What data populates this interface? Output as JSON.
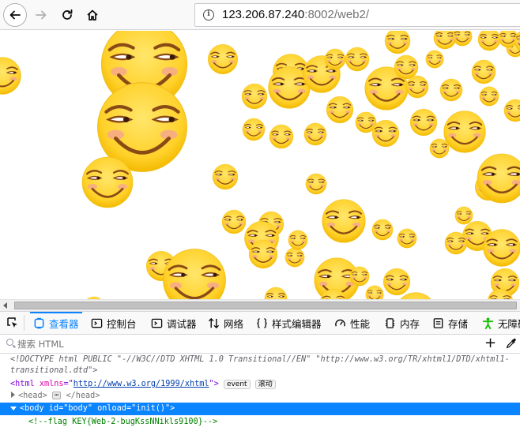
{
  "browser": {
    "url_host": "123.206.87.240",
    "url_rest": ":8002/web2/"
  },
  "devtools": {
    "tabs": [
      {
        "label": "查看器",
        "icon": "inspector-icon",
        "selected": true
      },
      {
        "label": "控制台",
        "icon": "console-icon"
      },
      {
        "label": "调试器",
        "icon": "debugger-icon"
      },
      {
        "label": "网络",
        "icon": "network-icon"
      },
      {
        "label": "样式编辑器",
        "icon": "style-editor-icon"
      },
      {
        "label": "性能",
        "icon": "performance-icon"
      },
      {
        "label": "内存",
        "icon": "memory-icon"
      },
      {
        "label": "存储",
        "icon": "storage-icon"
      },
      {
        "label": "无障碍",
        "icon": "accessibility-icon"
      }
    ],
    "search_placeholder": "搜索 HTML",
    "markup": {
      "doctype_line1": "<!DOCTYPE html PUBLIC \"-//W3C//DTD XHTML 1.0 Transitional//EN\" \"http://www.w3.org/TR/xhtml1/DTD/xhtml1-",
      "doctype_line2": "transitional.dtd\">",
      "html_open": "<html",
      "html_attr": "xmlns",
      "html_eq": "=\"",
      "html_val": "http://www.w3.org/1999/xhtml",
      "html_close": "\">",
      "badge_event": "event",
      "badge_scroll": "滚动",
      "head_open": "<head>",
      "head_dots": "⋯",
      "head_close": "</head>",
      "body_line": "<body id=\"body\" onload=\"init()\">",
      "comment_line": "<!--flag KEY{Web-2-bugKssNNikls9100}-->"
    }
  },
  "colors": {
    "accent": "#0a84ff",
    "smiley": "#ffd23f"
  }
}
